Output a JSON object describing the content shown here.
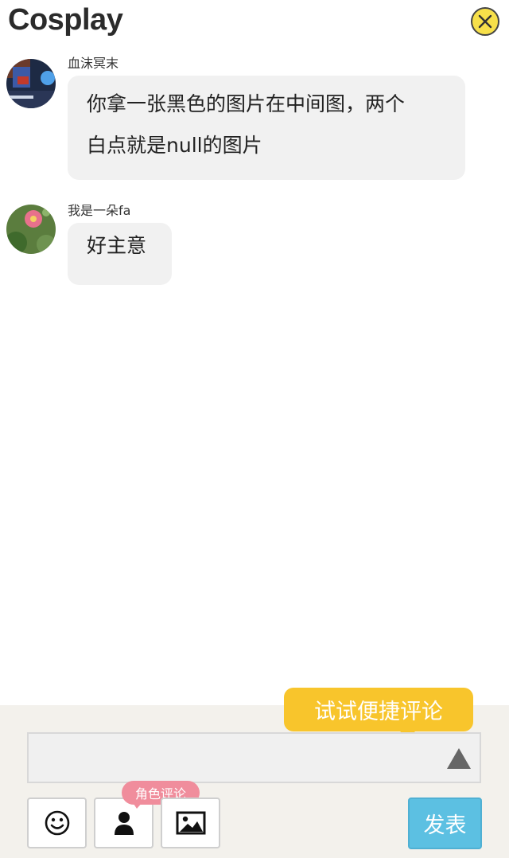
{
  "header": {
    "title": "Cosplay",
    "close_icon": "close-circle-icon"
  },
  "messages": [
    {
      "username": "血沫冥末",
      "lines": [
        "你拿一张黑色的图片在中间图，两个",
        "白点就是null的图片"
      ],
      "avatar": "user-avatar-1"
    },
    {
      "username": "我是一朵fa",
      "lines": [
        "好主意"
      ],
      "avatar": "user-avatar-2"
    }
  ],
  "composer": {
    "quick_comment_tip": "试试便捷评论",
    "input_value": "",
    "expand_icon": "triangle-up-icon",
    "tools": [
      {
        "name": "emoji",
        "icon": "smiley-icon"
      },
      {
        "name": "role",
        "icon": "person-icon",
        "badge": "角色评论"
      },
      {
        "name": "image",
        "icon": "image-icon"
      }
    ],
    "send_label": "发表"
  },
  "colors": {
    "close_fill": "#f7e04a",
    "tip_bg": "#f8c52c",
    "role_badge_bg": "#f08d9c",
    "send_bg": "#5cc0e2",
    "bubble_bg": "#f1f1f1",
    "footer_bg": "#f3f1ec"
  }
}
